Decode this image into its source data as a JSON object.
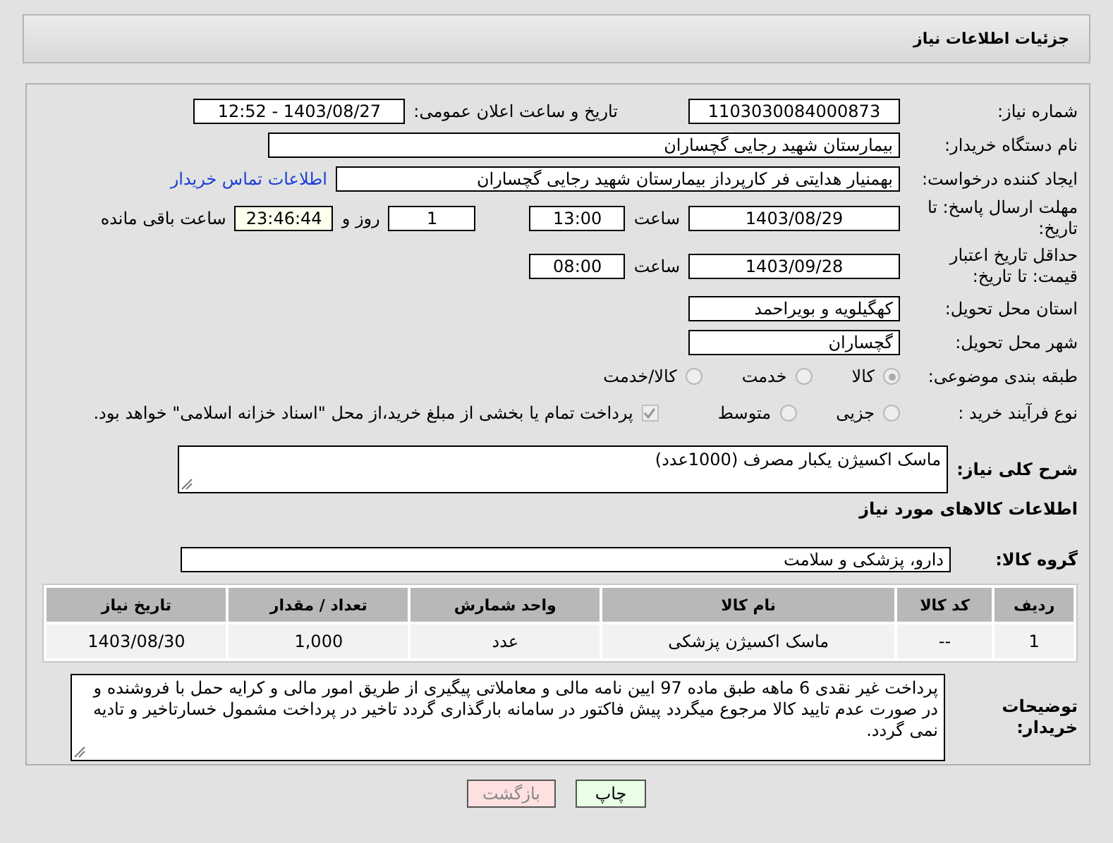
{
  "header": {
    "title": "جزئیات اطلاعات نیاز"
  },
  "need_number": {
    "label": "شماره نیاز:",
    "value": "1103030084000873"
  },
  "announce": {
    "label": "تاریخ و ساعت اعلان عمومی:",
    "value": "1403/08/27 - 12:52"
  },
  "buyer_org": {
    "label": "نام دستگاه خریدار:",
    "value": "بیمارستان شهید رجایی گچساران"
  },
  "requester": {
    "label": "ایجاد کننده درخواست:",
    "value": "بهمنیار هدایتی فر کارپرداز بیمارستان شهید رجایی گچساران",
    "link": "اطلاعات تماس خریدار"
  },
  "reply_deadline": {
    "label": "مهلت ارسال پاسخ: تا تاریخ:",
    "date": "1403/08/29",
    "time_label": "ساعت",
    "time": "13:00",
    "days": "1",
    "days_label": "روز و",
    "remaining": "23:46:44",
    "remaining_label": "ساعت باقی مانده"
  },
  "price_validity": {
    "label": "حداقل تاریخ اعتبار قیمت: تا تاریخ:",
    "date": "1403/09/28",
    "time_label": "ساعت",
    "time": "08:00"
  },
  "province": {
    "label": "استان محل تحویل:",
    "value": "کهگیلویه و بویراحمد"
  },
  "city": {
    "label": "شهر محل تحویل:",
    "value": "گچساران"
  },
  "category": {
    "label": "طبقه بندی موضوعی:",
    "options": [
      {
        "label": "کالا",
        "selected": true
      },
      {
        "label": "خدمت",
        "selected": false
      },
      {
        "label": "کالا/خدمت",
        "selected": false
      }
    ]
  },
  "process": {
    "label": "نوع فرآیند خرید :",
    "options": [
      {
        "label": "جزیی",
        "selected": false
      },
      {
        "label": "متوسط",
        "selected": false
      }
    ],
    "checkbox": {
      "label": "پرداخت تمام یا بخشی از مبلغ خرید،از محل \"اسناد خزانه اسلامی\" خواهد بود.",
      "checked": true
    }
  },
  "description": {
    "label": "شرح کلی نیاز:",
    "value": "ماسک اکسیژن یکبار مصرف  (1000عدد)"
  },
  "goods_title": "اطلاعات کالاهای مورد نیاز",
  "goods_group": {
    "label": "گروه کالا:",
    "value": "دارو، پزشکی و سلامت"
  },
  "table": {
    "columns": [
      "ردیف",
      "کد کالا",
      "نام کالا",
      "واحد شمارش",
      "تعداد / مقدار",
      "تاریخ نیاز"
    ],
    "rows": [
      [
        "1",
        "--",
        "ماسک اکسیژن پزشکی",
        "عدد",
        "1,000",
        "1403/08/30"
      ]
    ]
  },
  "buyer_notes": {
    "label": "توضیحات خریدار:",
    "value": "پرداخت غیر نقدی 6 ماهه  طبق ماده 97 ایین نامه مالی و معاملاتی پیگیری از طریق امور مالی  و کرایه حمل با فروشنده و در صورت عدم تایید کالا مرجوع میگردد پیش فاکتور در سامانه بارگذاری گردد  تاخیر  در پرداخت مشمول خسارتاخیر و تادیه نمی گردد."
  },
  "buttons": [
    {
      "label": "چاپ",
      "kind": "print"
    },
    {
      "label": "بازگشت",
      "kind": "back"
    }
  ]
}
